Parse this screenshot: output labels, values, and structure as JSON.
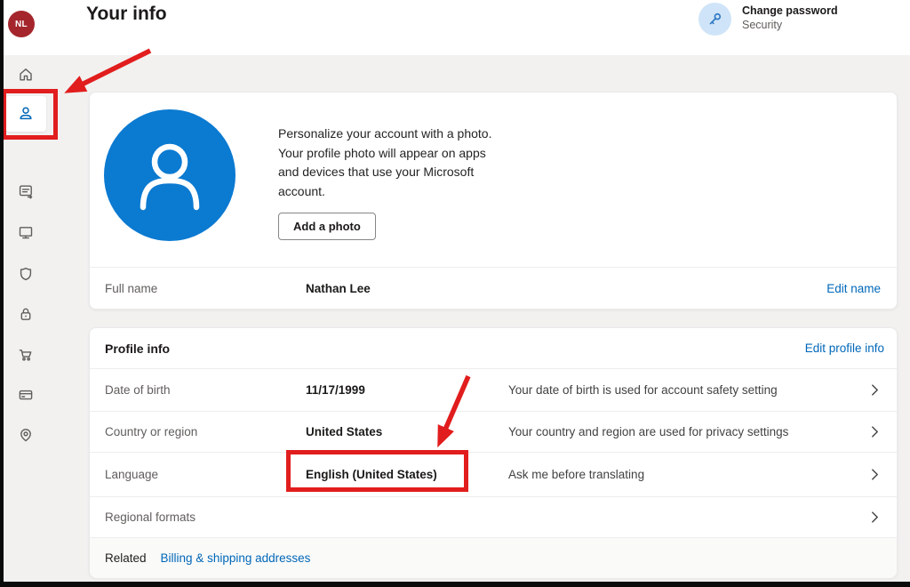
{
  "page": {
    "title": "Your info"
  },
  "header": {
    "avatar_initials": "NL",
    "quick_action": {
      "title": "Change password",
      "subtitle": "Security",
      "icon": "key-icon"
    }
  },
  "sidebar": {
    "items": [
      {
        "icon": "home-icon",
        "selected": false
      },
      {
        "icon": "person-icon",
        "selected": true
      },
      {
        "icon": "document-arrow-icon",
        "selected": false
      },
      {
        "icon": "monitor-icon",
        "selected": false
      },
      {
        "icon": "shield-icon",
        "selected": false
      },
      {
        "icon": "lock-icon",
        "selected": false
      },
      {
        "icon": "cart-icon",
        "selected": false
      },
      {
        "icon": "credit-card-icon",
        "selected": false
      },
      {
        "icon": "location-pin-icon",
        "selected": false
      }
    ]
  },
  "photo_card": {
    "description": "Personalize your account with a photo. Your profile photo will appear on apps and devices that use your Microsoft account.",
    "add_photo_label": "Add a photo",
    "full_name": {
      "label": "Full name",
      "value": "Nathan Lee",
      "action": "Edit name"
    }
  },
  "profile_card": {
    "title": "Profile info",
    "action": "Edit profile info",
    "rows": [
      {
        "label": "Date of birth",
        "value": "11/17/1999",
        "description": "Your date of birth is used for account safety setting"
      },
      {
        "label": "Country or region",
        "value": "United States",
        "description": "Your country and region are used for privacy settings"
      },
      {
        "label": "Language",
        "value": "English (United States)",
        "description": "Ask me before translating"
      },
      {
        "label": "Regional formats",
        "value": "",
        "description": ""
      }
    ],
    "footer": {
      "label": "Related",
      "link": "Billing & shipping addresses"
    }
  },
  "colors": {
    "accent_blue": "#0b7ad1",
    "link_blue": "#0067b8",
    "avatar_red": "#a4262c",
    "annotation_red": "#e11d1d",
    "page_background": "#f2f1f0"
  }
}
